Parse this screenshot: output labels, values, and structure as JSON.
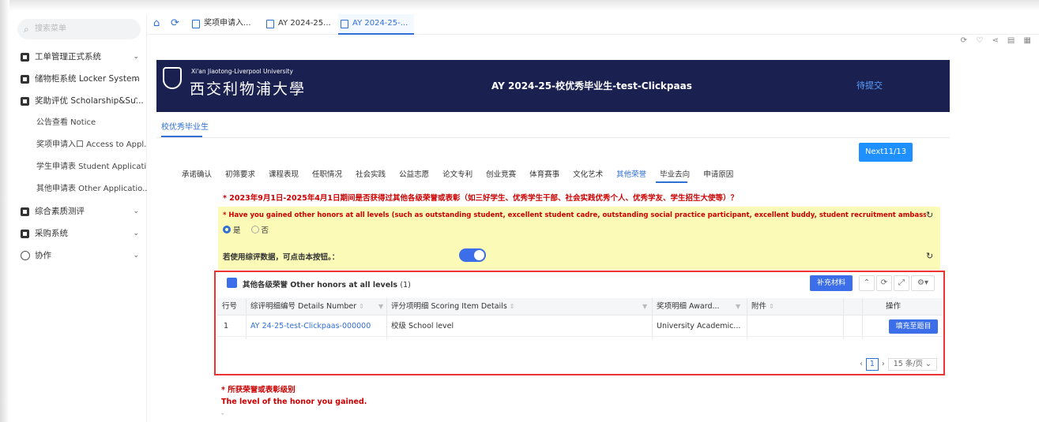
{
  "sidebar": {
    "search_placeholder": "搜索菜单",
    "menu": [
      {
        "label": "工单管理正式系统",
        "chev": "⌄"
      },
      {
        "label": "储物柜系统 Locker System",
        "chev": "⌄"
      },
      {
        "label": "奖助评优 Scholarship&Su...",
        "chev": "⌃"
      }
    ],
    "sub_items": [
      "公告查看 Notice",
      "奖项申请入口 Access to Appl...",
      "学生申请表 Student Applicati...",
      "其他申请表 Other Applicatio..."
    ],
    "menu2": [
      {
        "label": "综合素质测评",
        "chev": "⌄"
      },
      {
        "label": "采购系统",
        "chev": "⌄"
      },
      {
        "label": "协作",
        "chev": "⌄"
      }
    ]
  },
  "tabs": [
    "奖项申请入...",
    "AY 2024-25...",
    "AY 2024-25-..."
  ],
  "tools": "⟳ ♡ ⋖ ▤ ▦",
  "banner": {
    "uni_en": "Xi'an Jiaotong-Liverpool University",
    "uni_cn": "西交利物浦大學",
    "title": "AY 2024-25-校优秀毕业生-test-Clickpaas",
    "status": "待提交"
  },
  "segment": "校优秀毕业生",
  "next_label": "Next11/13",
  "steps": [
    "承诺确认",
    "初筛要求",
    "课程表现",
    "任职情况",
    "社会实践",
    "公益志愿",
    "论文专利",
    "创业竞赛",
    "体育赛事",
    "文化艺术",
    "其他荣誉",
    "毕业去向",
    "申请原因"
  ],
  "question1_cn": "* 2023年9月1日-2025年4月1日期间是否获得过其他各级荣誉或表彰（如三好学生、优秀学生干部、社会实践优秀个人、优秀学友、学生招生大使等）？",
  "question1_en": "* Have you gained other honors at all levels (such as outstanding student, excellent student cadre, outstanding social practice participant, excellent buddy, student recruitment ambassador and so ...",
  "radio_yes": "是",
  "radio_no": "否",
  "hint": "若使用综评数据，可点击本按钮。：",
  "panel": {
    "title": "其他各级荣誉 Other honors at all levels",
    "count": "(1)",
    "supp_label": "补充材料",
    "headers": [
      "行号",
      "综评明细编号 Details Number",
      "评分项明细 Scoring Item Details",
      "奖项明细 Award...",
      "附件",
      "操作"
    ],
    "row": [
      "1",
      "AY 24-25-test-Clickpaas-000000",
      "校级 School level",
      "University Academic...",
      "",
      ""
    ],
    "fill_label": "填充至题目",
    "page": "1",
    "page_size": "15 条/页 ⌄"
  },
  "question2_cn": "* 所获荣誉或表彰级别",
  "question2_en": "The level of the honor you gained.",
  "dash": "-"
}
